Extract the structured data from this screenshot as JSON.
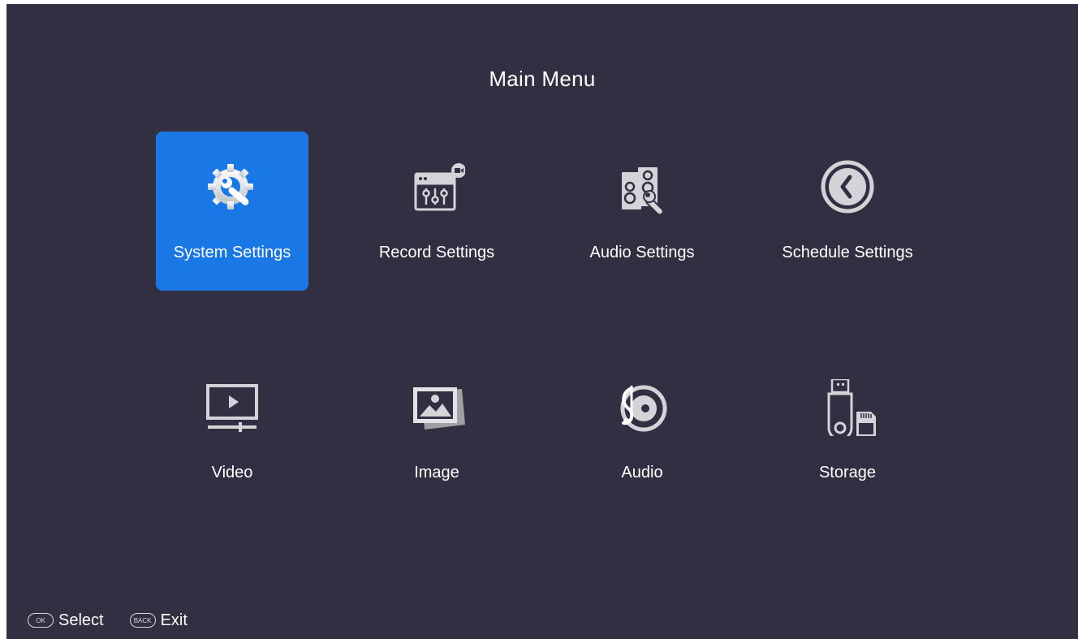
{
  "header": {
    "title": "Main Menu"
  },
  "menu": {
    "selected_index": 0,
    "items": [
      {
        "label": "System Settings",
        "icon": "gear-wrench-icon"
      },
      {
        "label": "Record Settings",
        "icon": "record-settings-icon"
      },
      {
        "label": "Audio Settings",
        "icon": "speaker-wrench-icon"
      },
      {
        "label": "Schedule Settings",
        "icon": "clock-icon"
      },
      {
        "label": "Video",
        "icon": "video-play-icon"
      },
      {
        "label": "Image",
        "icon": "image-icon"
      },
      {
        "label": "Audio",
        "icon": "music-disc-icon"
      },
      {
        "label": "Storage",
        "icon": "usb-sd-card-icon"
      }
    ]
  },
  "footer": {
    "select_key": "OK",
    "select_label": "Select",
    "exit_key": "BACK",
    "exit_label": "Exit"
  },
  "colors": {
    "background": "#322f42",
    "selected_tile": "#1a77e6",
    "icon_silver": "#d4d4d8"
  }
}
